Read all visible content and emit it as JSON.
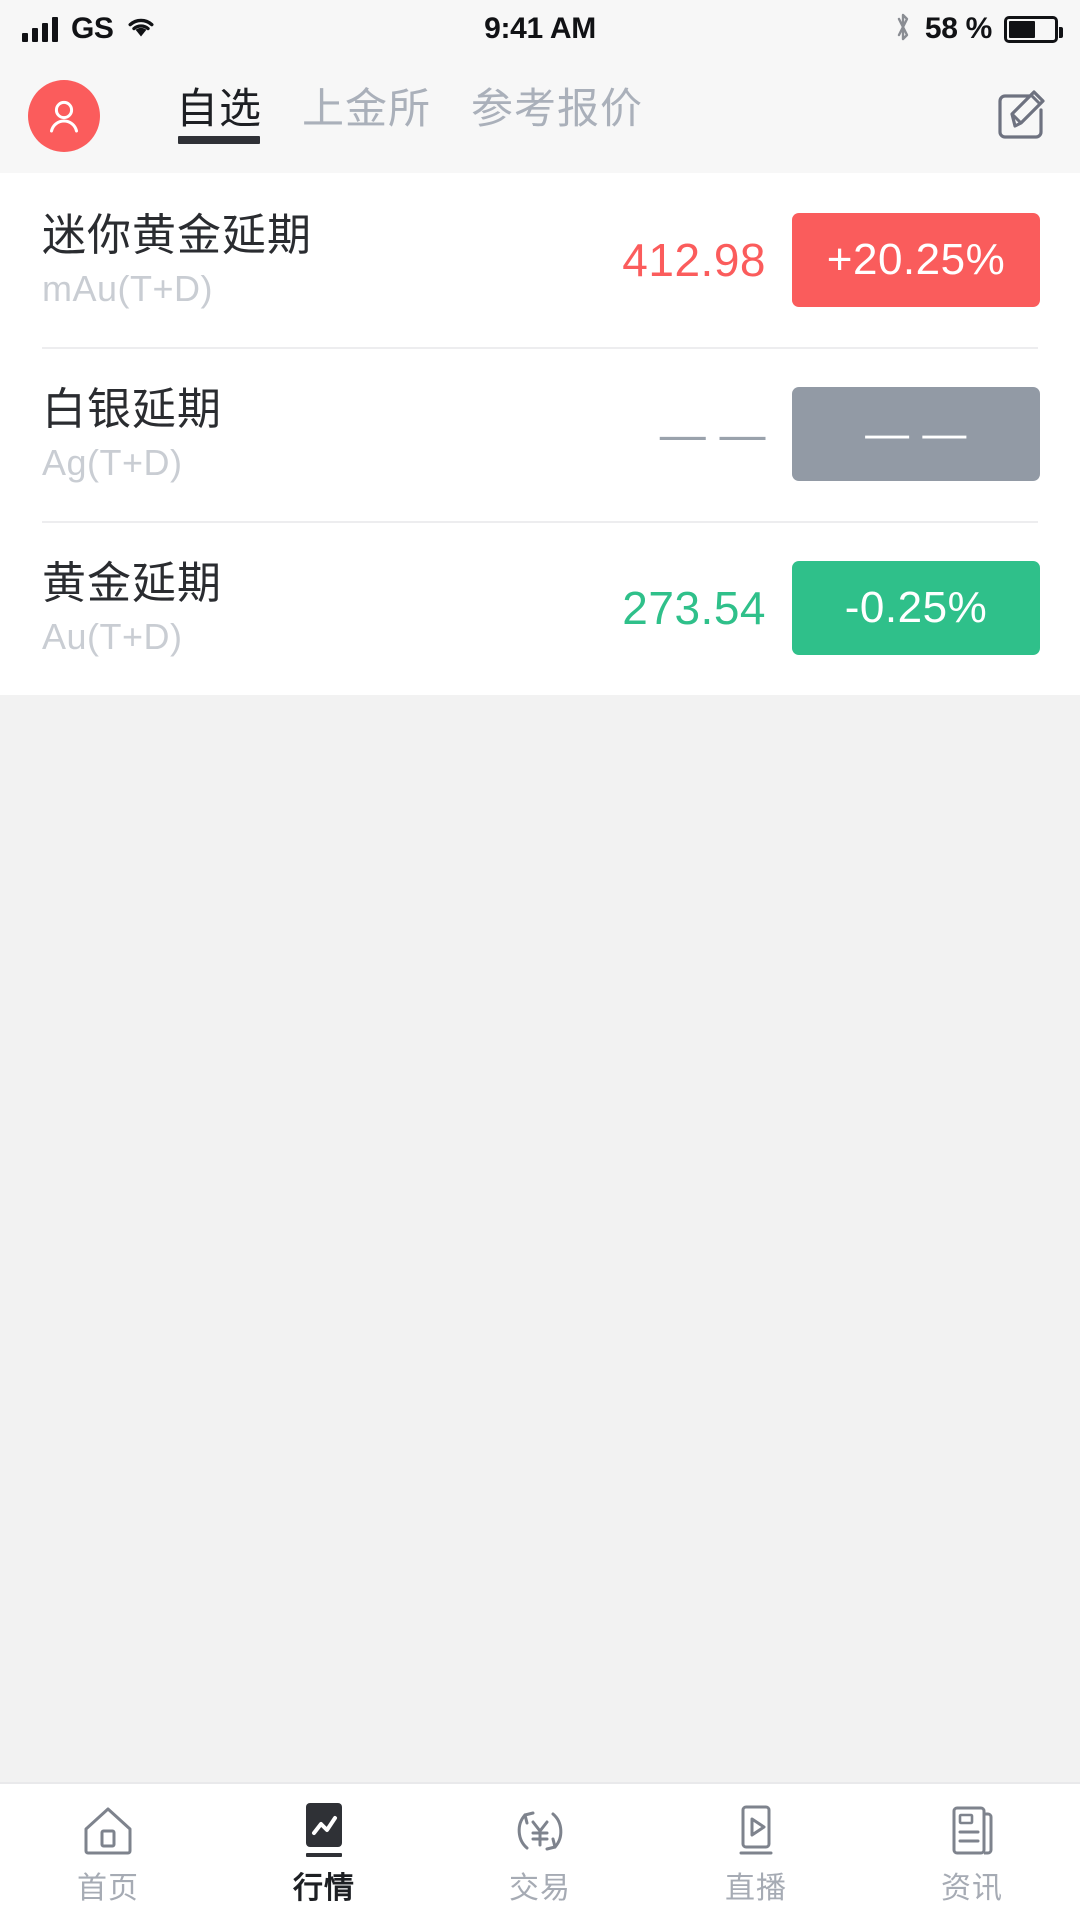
{
  "status_bar": {
    "carrier": "GS",
    "time": "9:41 AM",
    "battery_percent": "58 %",
    "battery_level": 58,
    "icons": {
      "signal": "signal-bars-icon",
      "wifi": "wifi-icon",
      "bluetooth": "bluetooth-icon",
      "battery": "battery-icon"
    }
  },
  "header": {
    "avatar_icon": "user-avatar-icon",
    "avatar_color": "#FB5C5C",
    "edit_icon": "edit-square-pencil-icon",
    "tabs": [
      {
        "label": "自选",
        "active": true
      },
      {
        "label": "上金所",
        "active": false
      },
      {
        "label": "参考报价",
        "active": false
      }
    ]
  },
  "quotes": [
    {
      "name_cn": "迷你黄金延期",
      "name_en": "mAu(T+D)",
      "price": "412.98",
      "change": "+20.25%",
      "direction": "up",
      "price_color": "#FB5C5C",
      "badge_color": "#FA5C5C"
    },
    {
      "name_cn": "白银延期",
      "name_en": "Ag(T+D)",
      "price": "— —",
      "change": "— —",
      "direction": "flat",
      "price_color": "#9AA2AC",
      "badge_color": "#929AA5"
    },
    {
      "name_cn": "黄金延期",
      "name_en": "Au(T+D)",
      "price": "273.54",
      "change": "-0.25%",
      "direction": "down",
      "price_color": "#2FC08A",
      "badge_color": "#2FC08A"
    }
  ],
  "tab_bar": {
    "items": [
      {
        "label": "首页",
        "icon": "home-icon",
        "active": false
      },
      {
        "label": "行情",
        "icon": "market-chart-icon",
        "active": true
      },
      {
        "label": "交易",
        "icon": "currency-exchange-icon",
        "active": false
      },
      {
        "label": "直播",
        "icon": "live-play-icon",
        "active": false
      },
      {
        "label": "资讯",
        "icon": "news-document-icon",
        "active": false
      }
    ]
  }
}
